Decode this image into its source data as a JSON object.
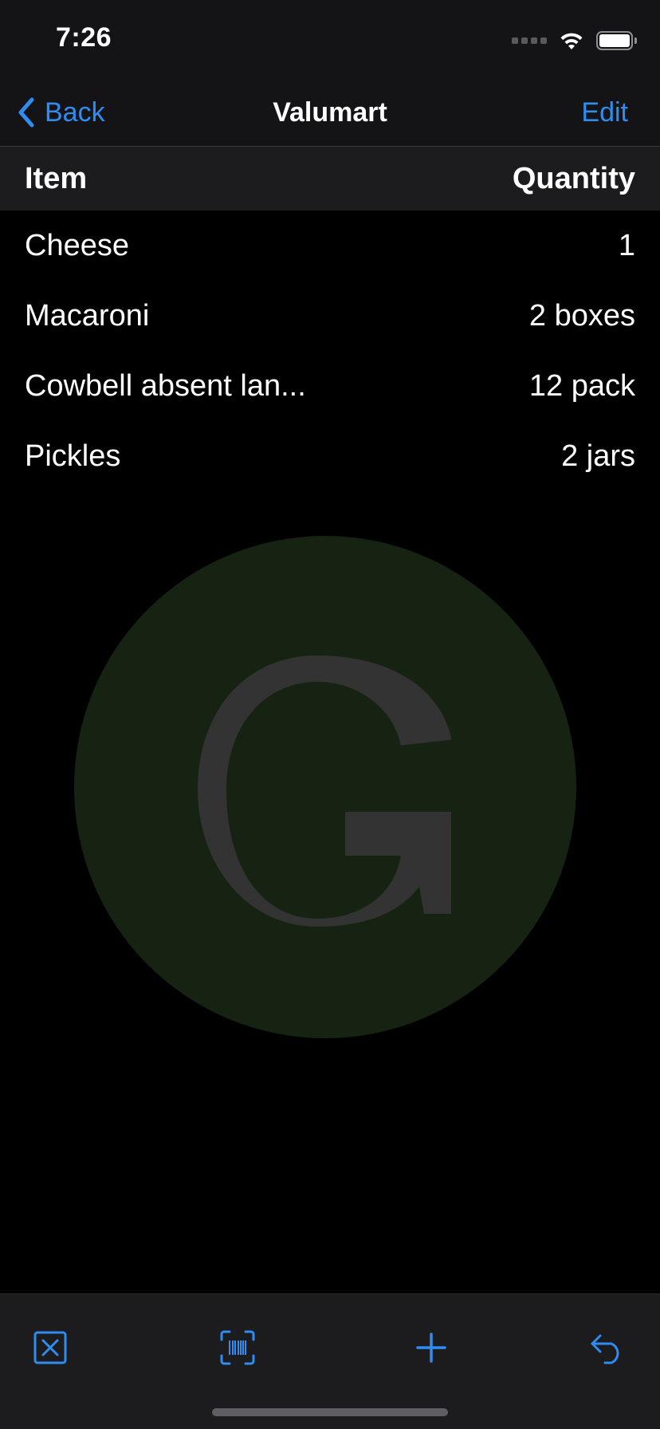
{
  "status_bar": {
    "time": "7:26"
  },
  "nav": {
    "back_label": "Back",
    "title": "Valumart",
    "edit_label": "Edit"
  },
  "columns": {
    "item": "Item",
    "quantity": "Quantity"
  },
  "items": [
    {
      "name": "Cheese",
      "quantity": "1"
    },
    {
      "name": "Macaroni",
      "quantity": "2 boxes"
    },
    {
      "name": "Cowbell absent lan...",
      "quantity": "12 pack"
    },
    {
      "name": "Pickles",
      "quantity": "2 jars"
    }
  ],
  "logo": {
    "letter": "G",
    "icon": "store-logo-g",
    "circle_color": "#172312",
    "letter_color": "#333333"
  },
  "toolbar": {
    "icons": [
      "clear-list-icon",
      "barcode-scan-icon",
      "add-item-icon",
      "undo-icon"
    ]
  },
  "colors": {
    "accent": "#2f8cf0",
    "background": "#000000",
    "bar_background": "#1c1c1e"
  }
}
